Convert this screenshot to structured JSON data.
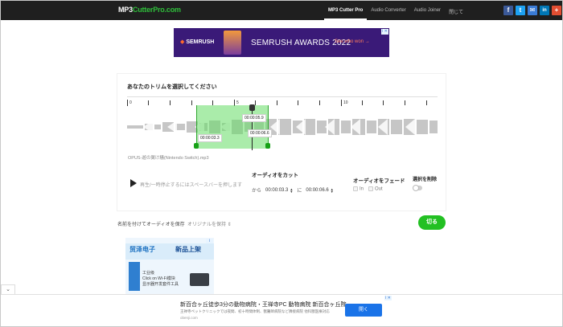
{
  "nav": {
    "logo_part1": "MP3",
    "logo_part2": "CutterPro.com",
    "links": [
      "MP3 Cutter Pro",
      "Audio Converter",
      "Audio Joiner",
      "閉じて"
    ],
    "social": [
      "f",
      "t",
      "✉",
      "in",
      "+"
    ],
    "social_colors": [
      "#3b5998",
      "#1da1f2",
      "#3a7bd5",
      "#0077b5",
      "#e14e32"
    ]
  },
  "ad_banner": {
    "logo": "SEMRUSH",
    "title": "SEMRUSH AWARDS 2022",
    "link": "See who won",
    "badge": "i ✕"
  },
  "trimmer": {
    "title": "あなたのトリムを選択してください",
    "ruler_labels": [
      "0",
      "5",
      "10"
    ],
    "tip_end": "00:00:05.9",
    "tip_start": "00:00:03.3",
    "tip_play": "00:00:06.6",
    "filename": "OPUS-遊の翼け騒(Nintendo Switch).mp3",
    "play_hint": "再生/一時停止するにはスペースバーを押します"
  },
  "cut": {
    "title": "オーディオをカット",
    "from_label": "から",
    "start_time": "00:00:03.3",
    "to_label": "に",
    "end_time": "00:00:06.6"
  },
  "fade": {
    "title": "オーディオをフェード",
    "in_label": "In",
    "out_label": "Out"
  },
  "reverse": {
    "title": "選択を削除"
  },
  "save": {
    "label": "名前を付けてオーディオを保存",
    "format": "オリジナルを保持 ⇕",
    "cut_button": "切る"
  },
  "side_ad": {
    "logo": "贸泽电子",
    "tag": "新品上架",
    "line1": "工业级",
    "line2": "Click on Wi-Fi模块",
    "line3": "显示器开发套件工具"
  },
  "bottom_ad": {
    "collapse": "⌄",
    "title": "新百合ヶ丘徒歩3分の動物病院・王禅寺PC 動物病院 新百合ヶ丘院",
    "desc": "王禅寺ペットクリニックでは夜間、初十時間体制、獣醫師病院など隣接病院 他科獣医療対応",
    "url": "obenji.com",
    "button": "開く",
    "badge": "i ✕"
  },
  "colors": {
    "accent_green": "#22c022",
    "selection": "#7fdc7f",
    "navbar": "#1f1f1f"
  }
}
